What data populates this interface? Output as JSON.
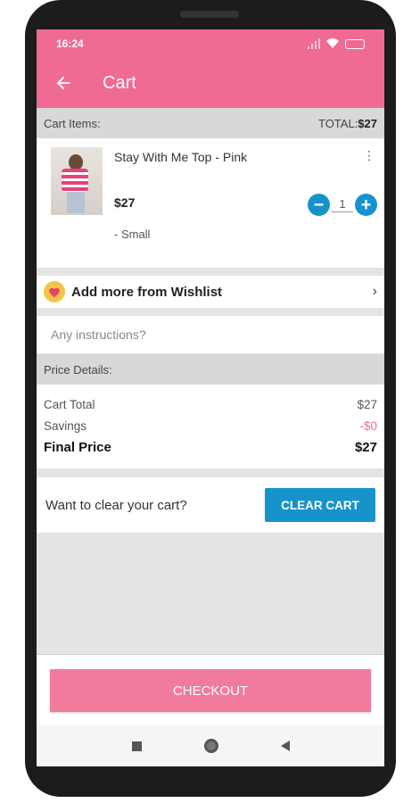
{
  "status_bar": {
    "time": "16:24",
    "battery_level": ""
  },
  "app_bar": {
    "title": "Cart"
  },
  "cart_section": {
    "label": "Cart Items:",
    "total_label": "TOTAL:",
    "total_value": "$27"
  },
  "cart_item": {
    "name": "Stay With Me Top - Pink",
    "price": "$27",
    "quantity": "1",
    "variant": "- Small",
    "qty_minus": "−",
    "qty_plus": "+"
  },
  "wishlist": {
    "label": "Add more from Wishlist"
  },
  "instructions": {
    "placeholder": "Any instructions?"
  },
  "price_details": {
    "label": "Price Details:",
    "rows": [
      {
        "label": "Cart Total",
        "value": "$27"
      },
      {
        "label": "Savings",
        "value": "-$0"
      },
      {
        "label": "Final Price",
        "value": "$27"
      }
    ]
  },
  "clear_cart": {
    "prompt": "Want to clear your cart?",
    "button_label": "CLEAR CART"
  },
  "checkout": {
    "button_label": "CHECKOUT"
  },
  "colors": {
    "brand_pink": "#f06b93",
    "action_blue": "#1793cc",
    "wishlist_yellow": "#f4c544"
  }
}
